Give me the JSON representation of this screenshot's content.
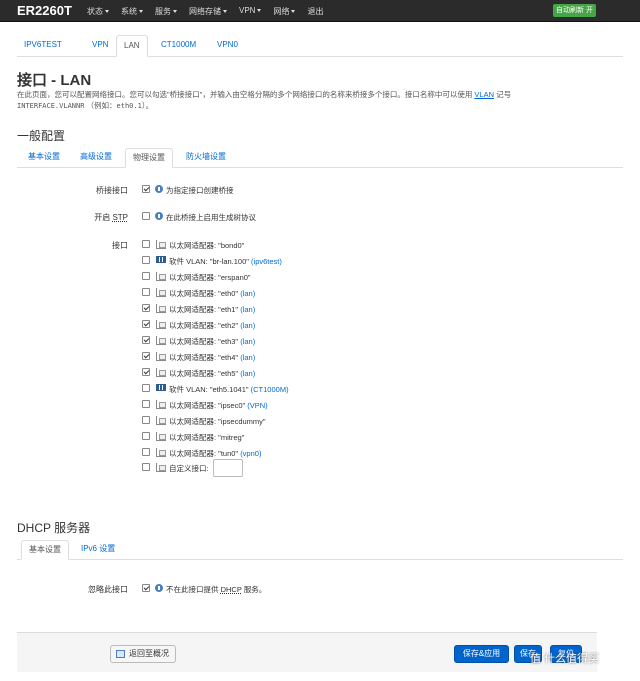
{
  "navbar": {
    "brand": "ER2260T",
    "menu": [
      {
        "label": "状态",
        "caret": true
      },
      {
        "label": "系统",
        "caret": true
      },
      {
        "label": "服务",
        "caret": true
      },
      {
        "label": "网络存储",
        "caret": true
      },
      {
        "label": "VPN",
        "caret": true
      },
      {
        "label": "网络",
        "caret": true
      },
      {
        "label": "退出",
        "caret": false
      }
    ],
    "refresh_badge": "自动刷新 开"
  },
  "top_tabs": [
    "IPV6TEST",
    "VPN",
    "LAN",
    "CT1000M",
    "VPN0"
  ],
  "page": {
    "title": "接口 - LAN",
    "desc_1": "在此页面，您可以配置网络接口。您可以勾选\"桥接接口\"，并输入由空格分隔的多个网络接口的名称来桥接多个接口。接口名称中可以使用",
    "desc_link": "VLAN",
    "desc_2": "记号",
    "desc_code": "INTERFACE.VLANNR",
    "desc_3": "（例如：",
    "desc_code2": "eth0.1",
    "desc_4": "）。"
  },
  "general": {
    "title": "一般配置",
    "tabs": [
      "基本设置",
      "高级设置",
      "物理设置",
      "防火墙设置"
    ],
    "bridge_label": "桥接接口",
    "bridge_text": "为指定接口创建桥接",
    "stp_label_prefix": "开启",
    "stp_label_abbr": "STP",
    "stp_text": "在此桥接上启用生成树协议",
    "iface_label": "接口",
    "interfaces": [
      {
        "checked": false,
        "icon": "ethernet-icon",
        "text": "以太网适配器: \"bond0\"",
        "net": ""
      },
      {
        "checked": false,
        "icon": "vlan-icon",
        "text": "软件 VLAN: \"br-lan.100\"",
        "net": "(ipv6test)"
      },
      {
        "checked": false,
        "icon": "ethernet-icon",
        "text": "以太网适配器: \"erspan0\"",
        "net": ""
      },
      {
        "checked": false,
        "icon": "ethernet-icon",
        "text": "以太网适配器: \"eth0\"",
        "net": "(lan)"
      },
      {
        "checked": true,
        "icon": "ethernet-icon",
        "text": "以太网适配器: \"eth1\"",
        "net": "(lan)"
      },
      {
        "checked": true,
        "icon": "ethernet-icon",
        "text": "以太网适配器: \"eth2\"",
        "net": "(lan)"
      },
      {
        "checked": true,
        "icon": "ethernet-icon",
        "text": "以太网适配器: \"eth3\"",
        "net": "(lan)"
      },
      {
        "checked": true,
        "icon": "ethernet-icon",
        "text": "以太网适配器: \"eth4\"",
        "net": "(lan)"
      },
      {
        "checked": true,
        "icon": "ethernet-icon",
        "text": "以太网适配器: \"eth5\"",
        "net": "(lan)"
      },
      {
        "checked": false,
        "icon": "vlan-icon",
        "text": "软件 VLAN: \"eth5.1041\"",
        "net": "(CT1000M)"
      },
      {
        "checked": false,
        "icon": "ethernet-icon",
        "text": "以太网适配器: \"ipsec0\"",
        "net": "(VPN)"
      },
      {
        "checked": false,
        "icon": "ethernet-icon",
        "text": "以太网适配器: \"ipsecdummy\"",
        "net": ""
      },
      {
        "checked": false,
        "icon": "ethernet-icon",
        "text": "以太网适配器: \"mitreg\"",
        "net": ""
      },
      {
        "checked": false,
        "icon": "ethernet-icon",
        "text": "以太网适配器: \"tun0\"",
        "net": "(vpn0)"
      }
    ],
    "custom_label": "自定义接口:",
    "custom_value": ""
  },
  "dhcp": {
    "title": "DHCP 服务器",
    "tabs": [
      "基本设置",
      "IPv6 设置"
    ],
    "ignore_label": "忽略此接口",
    "ignore_text_1": "不在此接口提供",
    "ignore_abbr": "DHCP",
    "ignore_text_2": "服务。"
  },
  "footer": {
    "back_label": "返回至概况",
    "save_apply_label": "保存&应用",
    "save_label": "保存",
    "reset_label": "复位"
  },
  "watermark": "值 什么值得买"
}
